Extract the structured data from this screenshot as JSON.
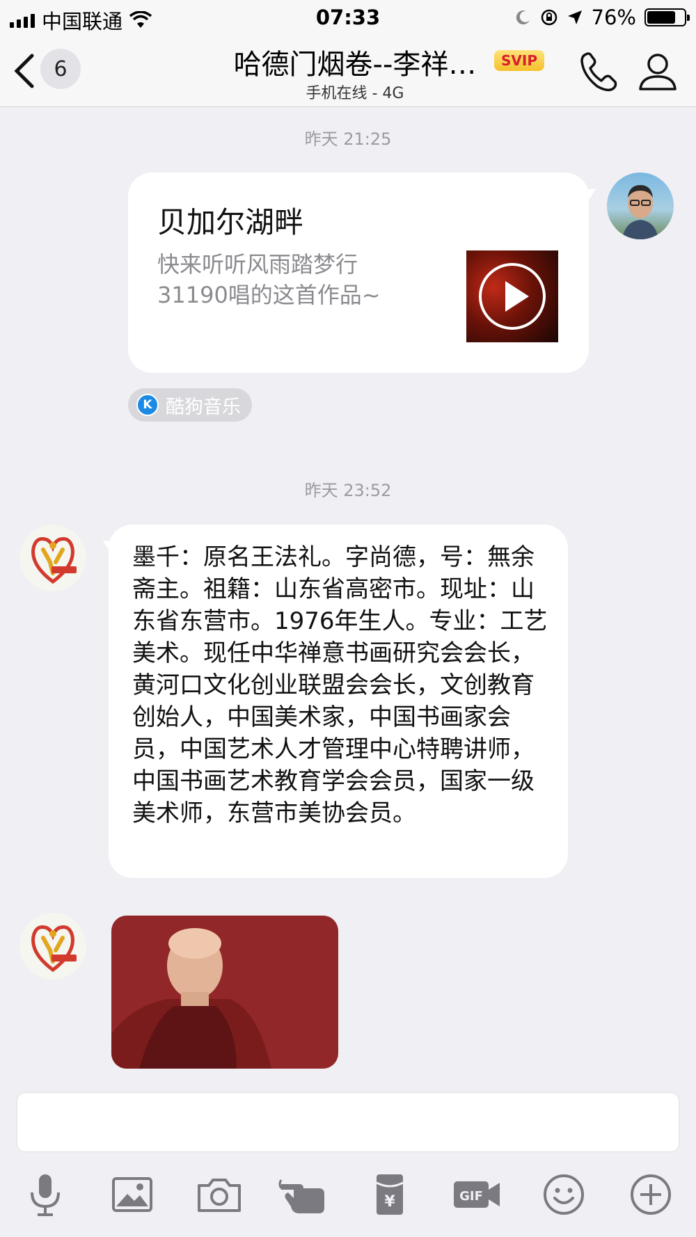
{
  "status_bar": {
    "carrier": "中国联通",
    "time": "07:33",
    "battery": "76%",
    "battery_level": 0.76
  },
  "nav": {
    "back_count": "6",
    "title": "哈德门烟卷--李祥…",
    "badge": "SVIP",
    "subtitle": "手机在线 - 4G"
  },
  "messages": {
    "time1": "昨天 21:25",
    "music": {
      "title": "贝加尔湖畔",
      "desc": "快来听听风雨踏梦行31190唱的这首作品~"
    },
    "source": {
      "icon": "K",
      "label": "酷狗音乐"
    },
    "time2": "昨天 23:52",
    "bio": "墨千：原名王法礼。字尚德，号：無余斋主。祖籍：山东省高密市。现址：山东省东营市。1976年生人。专业：工艺美术。现任中华禅意书画研究会会长，黄河口文化创业联盟会会长，文创教育创始人，中国美术家，中国书画家会员，中国艺术人才管理中心特聘讲师，中国书画艺术教育学会会员，国家一级美术师，东营市美协会员。"
  },
  "toolbar": {
    "icons": [
      "microphone-icon",
      "image-icon",
      "camera-icon",
      "poke-hand-icon",
      "red-packet-icon",
      "gif-icon",
      "emoji-icon",
      "plus-icon"
    ]
  }
}
